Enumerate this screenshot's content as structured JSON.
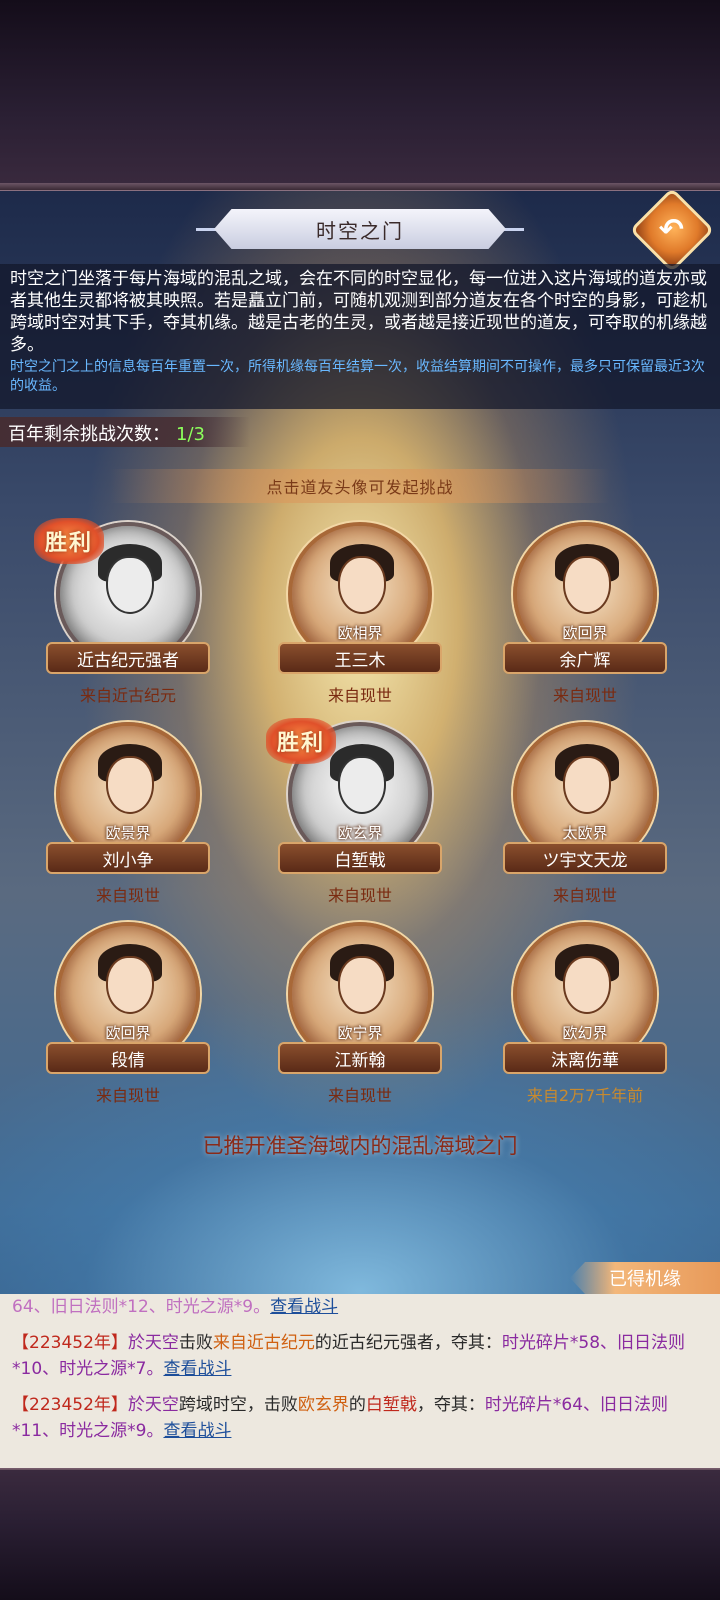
{
  "header": {
    "title": "时空之门",
    "back_icon": "back-arrow-icon"
  },
  "description": {
    "main": "时空之门坐落于每片海域的混乱之域，会在不同的时空显化，每一位进入这片海域的道友亦或者其他生灵都将被其映照。若是矗立门前，可随机观测到部分道友在各个时空的身影，可趁机跨域时空对其下手，夺其机缘。越是古老的生灵，或者越是接近现世的道友，可夺取的机缘越多。",
    "note": "时空之门之上的信息每百年重置一次，所得机缘每百年结算一次，收益结算期间不可操作，最多只可保留最近3次的收益。"
  },
  "remain": {
    "label": "百年剩余挑战次数：",
    "value": "1/3"
  },
  "hint": "点击道友头像可发起挑战",
  "win_badge_text": "胜利",
  "cards": [
    {
      "realm": "",
      "name": "近古纪元强者",
      "origin": "来自近古纪元",
      "won": true,
      "gray": true
    },
    {
      "realm": "欧相界",
      "name": "王三木",
      "origin": "来自现世",
      "won": false,
      "gray": false
    },
    {
      "realm": "欧回界",
      "name": "余广辉",
      "origin": "来自现世",
      "won": false,
      "gray": false
    },
    {
      "realm": "欧景界",
      "name": "刘小争",
      "origin": "来自现世",
      "won": false,
      "gray": false
    },
    {
      "realm": "欧玄界",
      "name": "白堑戟",
      "origin": "来自现世",
      "won": true,
      "gray": true
    },
    {
      "realm": "太欧界",
      "name": "ツ宇文天龙",
      "origin": "来自现世",
      "won": false,
      "gray": false
    },
    {
      "realm": "欧回界",
      "name": "段倩",
      "origin": "来自现世",
      "won": false,
      "gray": false
    },
    {
      "realm": "欧宁界",
      "name": "江新翰",
      "origin": "来自现世",
      "won": false,
      "gray": false
    },
    {
      "realm": "欧幻界",
      "name": "沫离伤華",
      "origin": "来自2万7千年前",
      "won": false,
      "gray": false,
      "gold": true
    }
  ],
  "pushed_text": "已推开准圣海域内的混乱海域之门",
  "gain_tab": "已得机缘",
  "log": {
    "line0_text": "64、旧日法则*12、时光之源*9。",
    "link": "查看战斗",
    "entry1": {
      "year": "【223452年】",
      "p1": "於天空",
      "p2": "击败",
      "from": "来自近古纪元",
      "p3": "的近古纪元强者，夺其：",
      "loot1": "时光碎片*58、旧日法则*10、时光之源*7。"
    },
    "entry2": {
      "year": "【223452年】",
      "p1": "於天空",
      "p2": "跨域时空，击败",
      "realm": "欧玄界",
      "p3": "的",
      "name": "白堑戟",
      "p4": "，夺其：",
      "loot_a": "时光碎",
      "loot_b": "片*64、旧日法则*11、时光之源*9。"
    }
  }
}
